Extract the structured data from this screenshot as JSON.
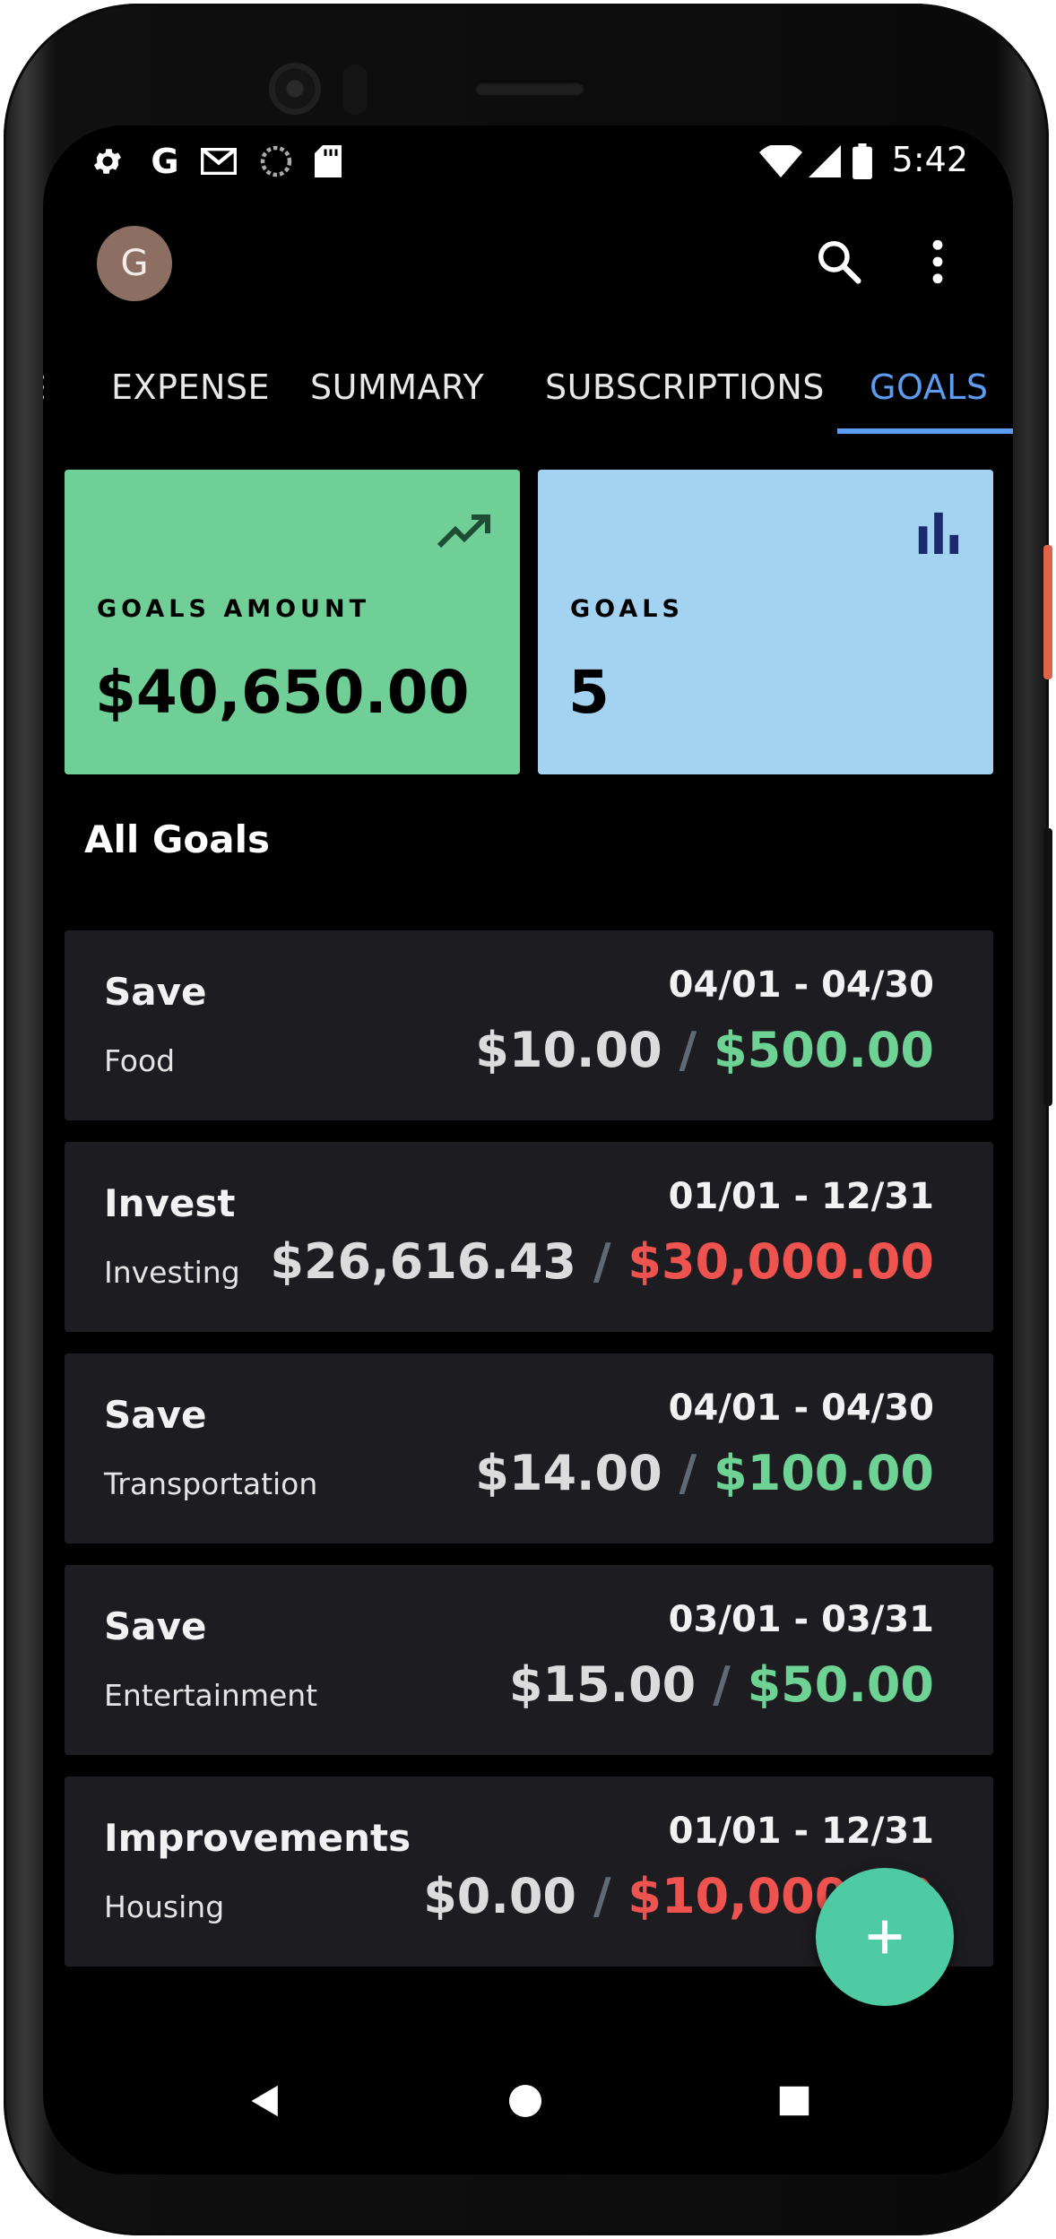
{
  "status_bar": {
    "time": "5:42",
    "left_icons": [
      "settings-icon",
      "google-icon",
      "gmail-icon",
      "sync-icon",
      "sd-card-icon"
    ],
    "right_icons": [
      "wifi-icon",
      "signal-icon",
      "battery-icon"
    ]
  },
  "app_bar": {
    "avatar_letter": "G",
    "actions": [
      "search-icon",
      "more-vert-icon"
    ]
  },
  "tabs": [
    {
      "label": "EXPENSE",
      "active": false
    },
    {
      "label": "SUMMARY",
      "active": false
    },
    {
      "label": "SUBSCRIPTIONS",
      "active": false
    },
    {
      "label": "GOALS",
      "active": true
    }
  ],
  "stats": {
    "goals_amount": {
      "label": "GOALS AMOUNT",
      "value": "$40,650.00",
      "color": "#6fcf97",
      "icon": "trending-up-icon"
    },
    "goals_count": {
      "label": "GOALS",
      "value": "5",
      "color": "#a4d3f2",
      "icon": "bar-chart-icon"
    }
  },
  "section_title": "All Goals",
  "goals": [
    {
      "title": "Save",
      "category": "Food",
      "dates": "04/01 - 04/30",
      "current": "$10.00",
      "separator": "/",
      "target": "$500.00",
      "status": "good"
    },
    {
      "title": "Invest",
      "category": "Investing",
      "dates": "01/01 - 12/31",
      "current": "$26,616.43",
      "separator": "/",
      "target": "$30,000.00",
      "status": "bad"
    },
    {
      "title": "Save",
      "category": "Transportation",
      "dates": "04/01 - 04/30",
      "current": "$14.00",
      "separator": "/",
      "target": "$100.00",
      "status": "good"
    },
    {
      "title": "Save",
      "category": "Entertainment",
      "dates": "03/01 - 03/31",
      "current": "$15.00",
      "separator": "/",
      "target": "$50.00",
      "status": "good"
    },
    {
      "title": "Improvements",
      "category": "Housing",
      "dates": "01/01 - 12/31",
      "current": "$0.00",
      "separator": "/",
      "target": "$10,000.00",
      "status": "bad"
    }
  ],
  "fab": {
    "icon": "add-icon"
  },
  "nav_bar": [
    "back-icon",
    "home-icon",
    "recents-icon"
  ]
}
